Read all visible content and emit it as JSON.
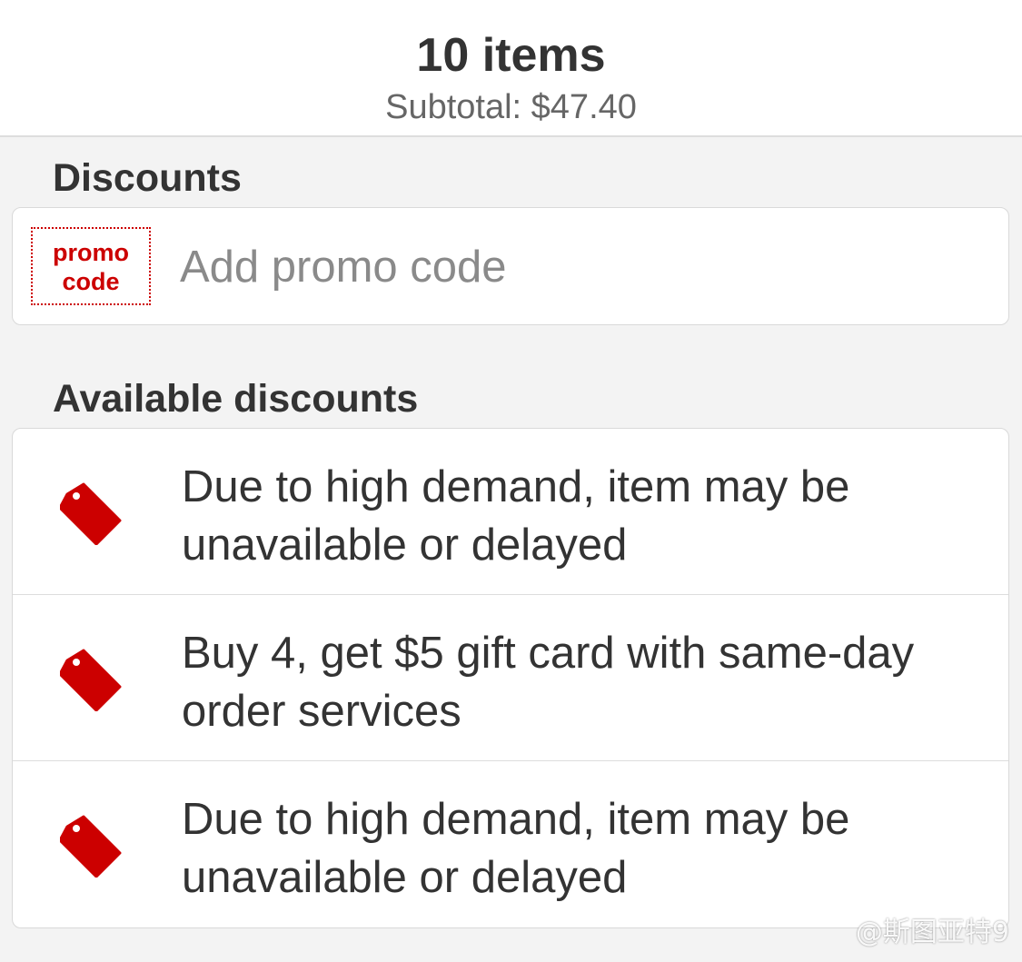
{
  "header": {
    "title": "10 items",
    "subtitle": "Subtotal: $47.40"
  },
  "discounts_section": {
    "heading": "Discounts",
    "promo_badge": [
      "promo",
      "code"
    ],
    "promo_placeholder": "Add promo code"
  },
  "available_section": {
    "heading": "Available discounts",
    "items": [
      {
        "icon": "tag-icon",
        "text": "Due to high demand, item may be unavailable or delayed"
      },
      {
        "icon": "tag-icon",
        "text": "Buy 4, get $5 gift card with same-day order services"
      },
      {
        "icon": "tag-icon",
        "text": "Due to high demand, item may be unavailable or delayed"
      }
    ]
  },
  "watermark": "@斯图亚特9",
  "colors": {
    "accent": "#cc0000",
    "background": "#f3f3f3",
    "card": "#ffffff"
  }
}
